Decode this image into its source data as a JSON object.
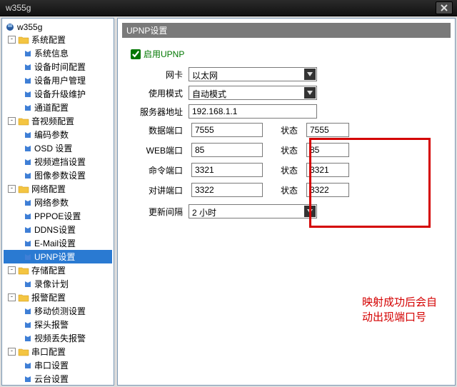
{
  "window": {
    "title": "w355g"
  },
  "tree": {
    "root": "w355g",
    "groups": [
      {
        "label": "系统配置",
        "items": [
          "系统信息",
          "设备时间配置",
          "设备用户管理",
          "设备升级维护",
          "通道配置"
        ]
      },
      {
        "label": "音视频配置",
        "items": [
          "编码参数",
          "OSD 设置",
          "视频遮挡设置",
          "图像参数设置"
        ]
      },
      {
        "label": "网络配置",
        "items": [
          "网络参数",
          "PPPOE设置",
          "DDNS设置",
          "E-Mail设置",
          "UPNP设置"
        ]
      },
      {
        "label": "存储配置",
        "items": [
          "录像计划"
        ]
      },
      {
        "label": "报警配置",
        "items": [
          "移动侦测设置",
          "探头报警",
          "视频丢失报警"
        ]
      },
      {
        "label": "串口配置",
        "items": [
          "串口设置",
          "云台设置"
        ]
      }
    ],
    "selected": "UPNP设置"
  },
  "panel": {
    "title": "UPNP设置",
    "enable_label": "启用UPNP",
    "labels": {
      "nic": "网卡",
      "mode": "使用模式",
      "server_addr": "服务器地址",
      "data_port": "数据端口",
      "web_port": "WEB端口",
      "cmd_port": "命令端口",
      "talk_port": "对讲端口",
      "status": "状态",
      "interval": "更新间隔"
    },
    "values": {
      "nic": "以太网",
      "mode": "自动模式",
      "server_addr": "192.168.1.1",
      "data_port": "7555",
      "web_port": "85",
      "cmd_port": "3321",
      "talk_port": "3322",
      "status_data": "7555",
      "status_web": "85",
      "status_cmd": "3321",
      "status_talk": "3322",
      "interval": "2 小时"
    }
  },
  "annotation": "映射成功后会自动出现端口号"
}
